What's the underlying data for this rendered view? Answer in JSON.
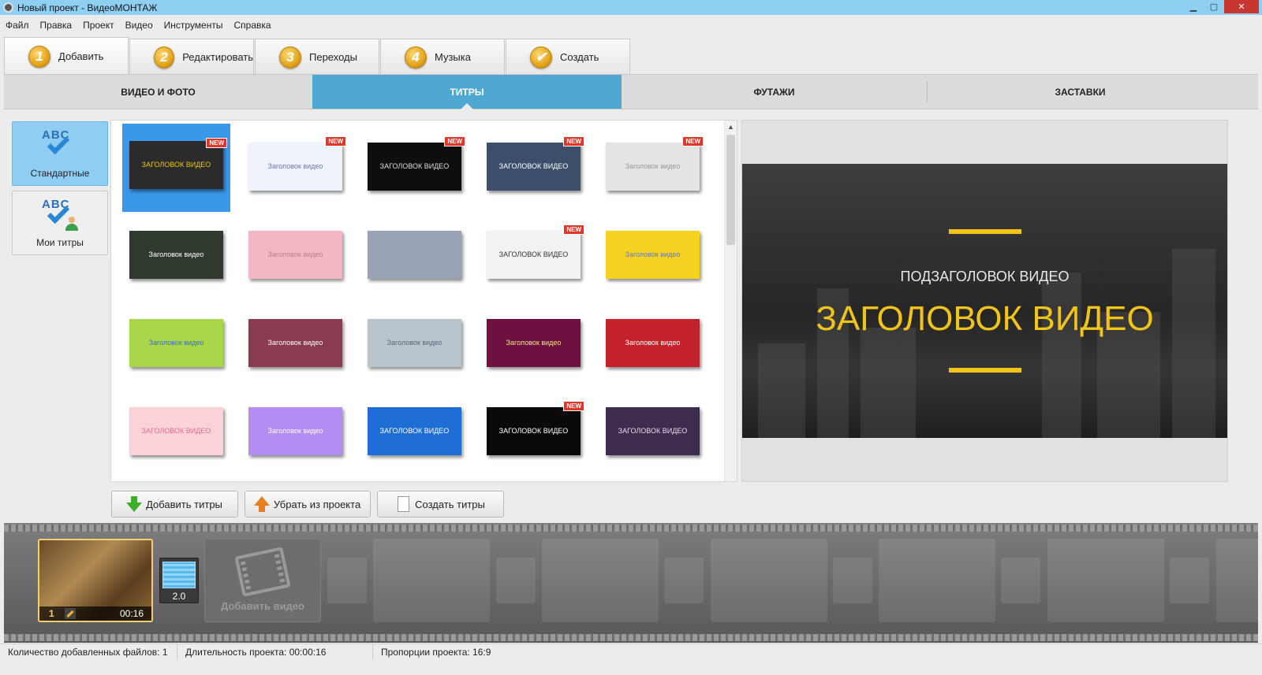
{
  "window": {
    "title": "Новый проект - ВидеоМОНТАЖ",
    "minimize": "▁",
    "maximize": "▢",
    "close": "✕"
  },
  "menu": [
    "Файл",
    "Правка",
    "Проект",
    "Видео",
    "Инструменты",
    "Справка"
  ],
  "steps": [
    {
      "num": "1",
      "label": "Добавить",
      "active": true
    },
    {
      "num": "2",
      "label": "Редактировать"
    },
    {
      "num": "3",
      "label": "Переходы"
    },
    {
      "num": "4",
      "label": "Музыка"
    },
    {
      "num": "✔",
      "label": "Создать"
    }
  ],
  "subtabs": [
    {
      "label": "ВИДЕО И ФОТО"
    },
    {
      "label": "ТИТРЫ",
      "active": true
    },
    {
      "label": "ФУТАЖИ"
    },
    {
      "label": "ЗАСТАВКИ"
    }
  ],
  "categories": [
    {
      "label": "Стандартные",
      "icon": "abc-check-icon",
      "active": true
    },
    {
      "label": "Мои титры",
      "icon": "abc-user-icon"
    }
  ],
  "new_badge": "NEW",
  "title_templates": [
    {
      "text": "ЗАГОЛОВОК ВИДЕО",
      "new": true,
      "selected": true,
      "bg": "#2b2b2b",
      "fg": "#f0c419"
    },
    {
      "text": "Заголовок видео",
      "new": true,
      "bg": "#eef2fa",
      "fg": "#6a7aa8"
    },
    {
      "text": "ЗАГОЛОВОК ВИДЕО",
      "new": true,
      "bg": "#0e0e0e",
      "fg": "#dddddd"
    },
    {
      "text": "ЗАГОЛОВОК ВИДЕО",
      "new": true,
      "bg": "#3d4e6a",
      "fg": "#ffffff"
    },
    {
      "text": "Заголовок видео",
      "new": true,
      "bg": "#e4e4e4",
      "fg": "#999999"
    },
    {
      "text": "Заголовок видео",
      "bg": "#2f3a2f",
      "fg": "#ffffff"
    },
    {
      "text": "Заголовок видео",
      "bg": "#f2b7c3",
      "fg": "#c27a88"
    },
    {
      "text": "",
      "bg": "#9aa2b6",
      "fg": "#ffffff"
    },
    {
      "text": "ЗАГОЛОВОК ВИДЕО",
      "new": true,
      "bg": "#f2f2f2",
      "fg": "#333333"
    },
    {
      "text": "Заголовок видео",
      "bg": "#f6d320",
      "fg": "#5d79c9"
    },
    {
      "text": "Заголовок видео",
      "bg": "#a9d64a",
      "fg": "#3a6fc4"
    },
    {
      "text": "Заголовок видео",
      "bg": "#8a3b4f",
      "fg": "#ffffff"
    },
    {
      "text": "Заголовок видео",
      "bg": "#b9c4cc",
      "fg": "#556677"
    },
    {
      "text": "Заголовок видео",
      "bg": "#6e1140",
      "fg": "#f2e38a"
    },
    {
      "text": "Заголовок видео",
      "bg": "#c4222a",
      "fg": "#ffffff"
    },
    {
      "text": "ЗАГОЛОВОК ВИДЕО",
      "bg": "#fbd2d6",
      "fg": "#e06b9a"
    },
    {
      "text": "Заголовок видео",
      "bg": "#b38df2",
      "fg": "#ffffff"
    },
    {
      "text": "ЗАГОЛОВОК ВИДЕО",
      "bg": "#1f6ed6",
      "fg": "#ffffff"
    },
    {
      "text": "ЗАГОЛОВОК ВИДЕО",
      "new": true,
      "bg": "#0a0a0a",
      "fg": "#ffffff"
    },
    {
      "text": "ЗАГОЛОВОК ВИДЕО",
      "bg": "#3e2c4e",
      "fg": "#e8d8f0"
    }
  ],
  "preview": {
    "subtitle": "ПОДЗАГОЛОВОК ВИДЕО",
    "title": "ЗАГОЛОВОК ВИДЕО",
    "accent": "#f0c419"
  },
  "actions": [
    {
      "label": "Добавить титры",
      "icon": "arrow-down-icon"
    },
    {
      "label": "Убрать из проекта",
      "icon": "arrow-up-icon"
    },
    {
      "label": "Создать титры",
      "icon": "document-icon"
    }
  ],
  "timeline": {
    "clip": {
      "index": "1",
      "duration": "00:16"
    },
    "transition": {
      "duration": "2.0"
    },
    "add_video": "Добавить видео"
  },
  "status": {
    "files": "Количество добавленных файлов: 1",
    "duration": "Длительность проекта:  00:00:16",
    "ratio": "Пропорции проекта:  16:9"
  }
}
